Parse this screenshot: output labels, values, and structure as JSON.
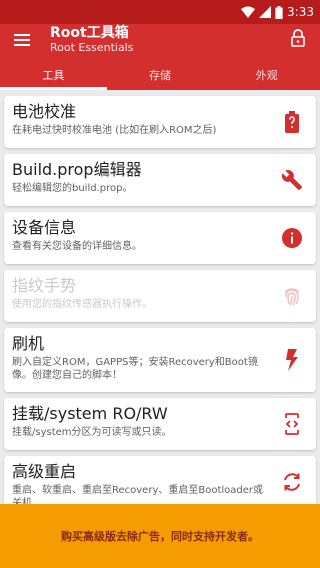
{
  "status_bar": {
    "time": "3:33"
  },
  "app": {
    "title": "Root工具箱",
    "subtitle": "Root Essentials"
  },
  "tabs": [
    {
      "label": "工具"
    },
    {
      "label": "存储"
    },
    {
      "label": "外观"
    }
  ],
  "cards": [
    {
      "title": "电池校准",
      "desc": "在耗电过快时校准电池 (比如在刷入ROM之后)",
      "icon": "battery-alert-icon"
    },
    {
      "title": "Build.prop编辑器",
      "desc": "轻松编辑您的build.prop。",
      "icon": "wrench-icon"
    },
    {
      "title": "设备信息",
      "desc": "查看有关您设备的详细信息。",
      "icon": "info-icon"
    },
    {
      "title": "指纹手势",
      "desc": "使用您的指纹传感器执行操作。",
      "icon": "fingerprint-icon"
    },
    {
      "title": "刷机",
      "desc": "刷入自定义ROM，GAPPS等；安装Recovery和Boot镜像。创建您自己的脚本！",
      "icon": "flash-icon"
    },
    {
      "title": "挂载/system RO/RW",
      "desc": "挂载/system分区为可读写或只读。",
      "icon": "code-phone-icon"
    },
    {
      "title": "高级重启",
      "desc": "重启、软重启、重启至Recovery、重启至Bootloader或关机",
      "icon": "restart-icon"
    }
  ],
  "banner": {
    "text": "购买高级版去除广告，同时支持开发者。"
  },
  "colors": {
    "primary": "#d32f2f",
    "primary_dark": "#b71c1c",
    "banner": "#f59c00",
    "banner_text": "#8a2a12"
  }
}
